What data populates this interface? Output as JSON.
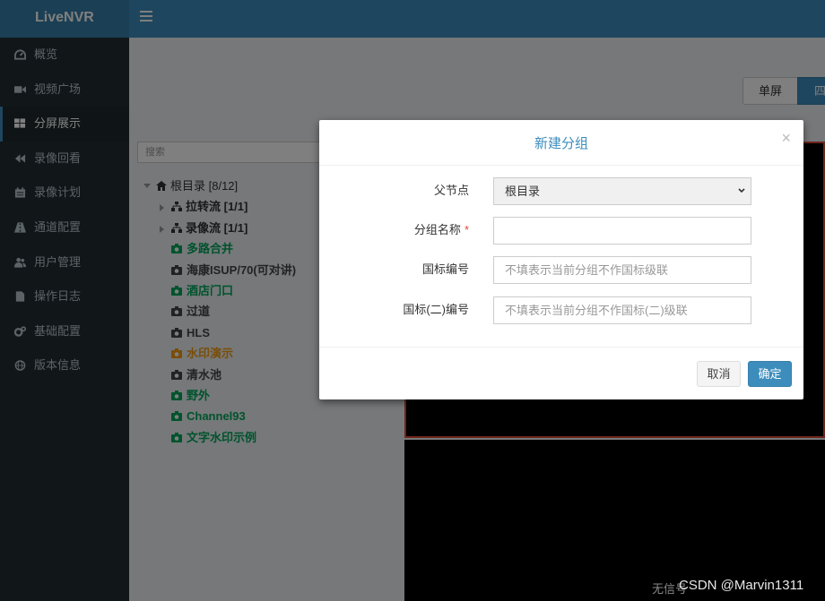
{
  "app": {
    "logo_text": "LiveNVR"
  },
  "sidebar": {
    "items": [
      {
        "label": "概览",
        "icon": "dashboard-icon"
      },
      {
        "label": "视频广场",
        "icon": "video-camera-icon"
      },
      {
        "label": "分屏展示",
        "icon": "grid-icon",
        "active": true
      },
      {
        "label": "录像回看",
        "icon": "backward-icon"
      },
      {
        "label": "录像计划",
        "icon": "calendar-icon"
      },
      {
        "label": "通道配置",
        "icon": "road-icon"
      },
      {
        "label": "用户管理",
        "icon": "users-icon"
      },
      {
        "label": "操作日志",
        "icon": "file-icon"
      },
      {
        "label": "基础配置",
        "icon": "cogs-icon"
      },
      {
        "label": "版本信息",
        "icon": "globe-icon"
      }
    ]
  },
  "main": {
    "screen_toggle": {
      "single_label": "单屏",
      "four_label": "四"
    },
    "tree_search_placeholder": "搜索",
    "tree": {
      "root_label": "根目录 [8/12]",
      "folders": [
        {
          "label": "拉转流 [1/1]"
        },
        {
          "label": "录像流 [1/1]"
        }
      ],
      "channels": [
        {
          "label": "多路合并",
          "status": "online"
        },
        {
          "label": "海康ISUP/70(可对讲)",
          "status": "offline"
        },
        {
          "label": "酒店门口",
          "status": "online"
        },
        {
          "label": "过道",
          "status": "offline"
        },
        {
          "label": "HLS",
          "status": "offline"
        },
        {
          "label": "水印演示",
          "status": "recording"
        },
        {
          "label": "清水池",
          "status": "offline"
        },
        {
          "label": "野外",
          "status": "online"
        },
        {
          "label": "Channel93",
          "status": "online"
        },
        {
          "label": "文字水印示例",
          "status": "online"
        }
      ]
    },
    "watermark_text": "无信号",
    "csdn_text": "CSDN @Marvin1311"
  },
  "modal": {
    "title": "新建分组",
    "close_glyph": "×",
    "fields": {
      "parent": {
        "label": "父节点",
        "value": "根目录"
      },
      "name": {
        "label": "分组名称",
        "required_mark": "*",
        "value": ""
      },
      "gb_code": {
        "label": "国标编号",
        "placeholder": "不填表示当前分组不作国标级联"
      },
      "gb2_code": {
        "label": "国标(二)编号",
        "placeholder": "不填表示当前分组不作国标(二)级联"
      }
    },
    "buttons": {
      "cancel": "取消",
      "ok": "确定"
    }
  },
  "colors": {
    "primary": "#3c8dbc",
    "sidebar_bg": "#222d32",
    "online": "#00a65a",
    "recording": "#f39c12",
    "danger": "#dd4b39"
  }
}
